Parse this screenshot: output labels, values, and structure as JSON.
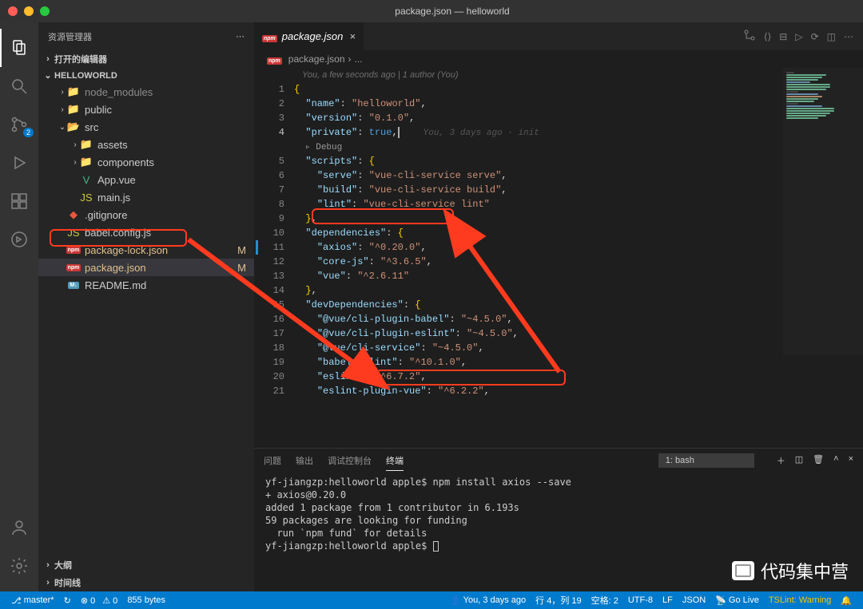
{
  "titlebar": {
    "title": "package.json — helloworld"
  },
  "sidebar": {
    "title": "资源管理器",
    "open_editors": "打开的编辑器",
    "project": "HELLOWORLD",
    "outline": "大纲",
    "timeline": "时间线",
    "tree": {
      "node_modules": "node_modules",
      "public": "public",
      "src": "src",
      "assets": "assets",
      "components": "components",
      "app_vue": "App.vue",
      "main_js": "main.js",
      "gitignore": ".gitignore",
      "babel": "babel.config.js",
      "pkg_lock": "package-lock.json",
      "pkg": "package.json",
      "readme": "README.md",
      "git_m": "M"
    }
  },
  "scm_badge": "2",
  "tab": {
    "label": "package.json"
  },
  "breadcrumb": {
    "file": "package.json",
    "sep": "›",
    "more": "..."
  },
  "gitlens": {
    "header": "You, a few seconds ago | 1 author (You)",
    "inline": "You, 3 days ago · init",
    "debug": "▹ Debug"
  },
  "code": {
    "lines": [
      {
        "n": 1,
        "raw": "{"
      },
      {
        "n": 2,
        "raw": "  \"name\": \"helloworld\","
      },
      {
        "n": 3,
        "raw": "  \"version\": \"0.1.0\","
      },
      {
        "n": 4,
        "raw": "  \"private\": true,",
        "gitlens": true,
        "active": true
      },
      {
        "n": "",
        "raw": "DEBUG"
      },
      {
        "n": 5,
        "raw": "  \"scripts\": {"
      },
      {
        "n": 6,
        "raw": "    \"serve\": \"vue-cli-service serve\","
      },
      {
        "n": 7,
        "raw": "    \"build\": \"vue-cli-service build\","
      },
      {
        "n": 8,
        "raw": "    \"lint\": \"vue-cli-service lint\""
      },
      {
        "n": 9,
        "raw": "  },"
      },
      {
        "n": 10,
        "raw": "  \"dependencies\": {"
      },
      {
        "n": 11,
        "raw": "    \"axios\": \"^0.20.0\",",
        "modified": true
      },
      {
        "n": 12,
        "raw": "    \"core-js\": \"^3.6.5\","
      },
      {
        "n": 13,
        "raw": "    \"vue\": \"^2.6.11\""
      },
      {
        "n": 14,
        "raw": "  },"
      },
      {
        "n": 15,
        "raw": "  \"devDependencies\": {"
      },
      {
        "n": 16,
        "raw": "    \"@vue/cli-plugin-babel\": \"~4.5.0\","
      },
      {
        "n": 17,
        "raw": "    \"@vue/cli-plugin-eslint\": \"~4.5.0\","
      },
      {
        "n": 18,
        "raw": "    \"@vue/cli-service\": \"~4.5.0\","
      },
      {
        "n": 19,
        "raw": "    \"babel-eslint\": \"^10.1.0\","
      },
      {
        "n": 20,
        "raw": "    \"eslint\": \"^6.7.2\","
      },
      {
        "n": 21,
        "raw": "    \"eslint-plugin-vue\": \"^6.2.2\","
      }
    ]
  },
  "panel": {
    "tabs": {
      "problems": "问题",
      "output": "输出",
      "debug": "调试控制台",
      "terminal": "终端"
    },
    "shell": "1: bash",
    "lines": [
      "yf-jiangzp:helloworld apple$ npm install axios --save",
      "+ axios@0.20.0",
      "added 1 package from 1 contributor in 6.193s",
      "",
      "59 packages are looking for funding",
      "  run `npm fund` for details",
      "",
      "yf-jiangzp:helloworld apple$ "
    ]
  },
  "statusbar": {
    "branch": "master*",
    "sync": "↻",
    "errors": "⊗ 0",
    "warnings": "⚠ 0",
    "size": "855 bytes",
    "blame": "You, 3 days ago",
    "ln_col": "行 4，列 19",
    "spaces": "空格: 2",
    "encoding": "UTF-8",
    "eol": "LF",
    "lang": "JSON",
    "golive": "Go Live",
    "tslint": "TSLint: Warning",
    "bell": "🔔"
  },
  "watermark": "代码集中营"
}
